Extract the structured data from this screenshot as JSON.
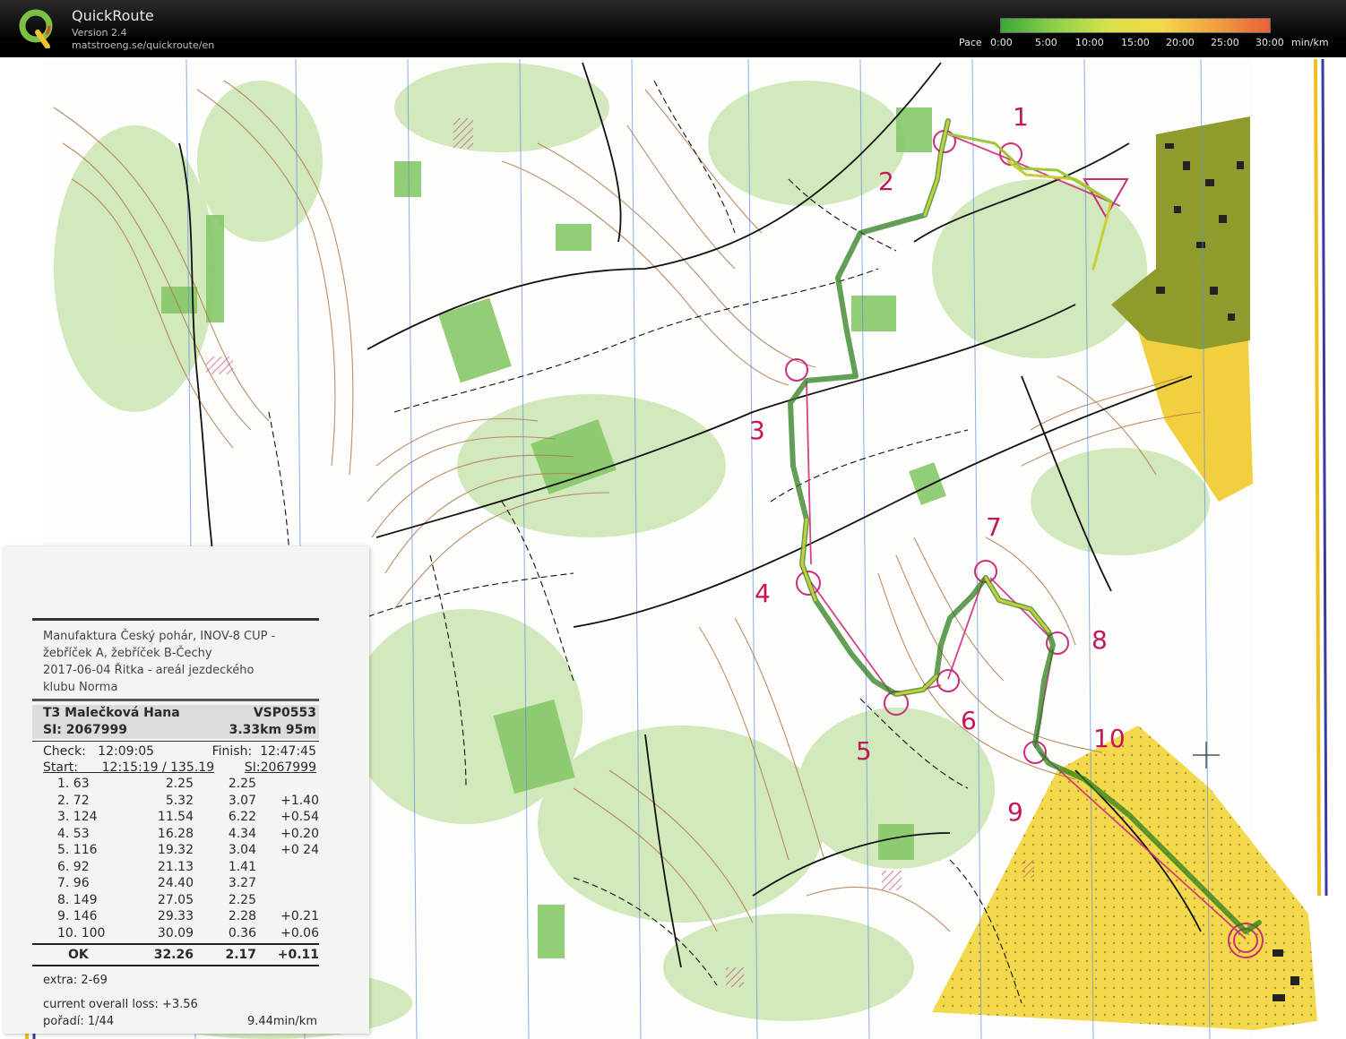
{
  "app": {
    "name": "QuickRoute",
    "version": "Version 2.4",
    "url": "matstroeng.se/quickroute/en"
  },
  "pace_legend": {
    "label": "Pace",
    "ticks": [
      "0:00",
      "5:00",
      "10:00",
      "15:00",
      "20:00",
      "25:00",
      "30:00"
    ],
    "unit": "min/km",
    "colors": [
      "#3aa83a",
      "#8cd04a",
      "#d8e24a",
      "#f4d84a",
      "#f0a040",
      "#e8603a"
    ]
  },
  "map": {
    "control_numbers": [
      "1",
      "2",
      "3",
      "4",
      "5",
      "6",
      "7",
      "8",
      "9",
      "10"
    ],
    "colors": {
      "forest_green": "#7cc65a",
      "light_green": "#c8e6b0",
      "open_yellow": "#f2d64a",
      "contour_brown": "#b0764a",
      "control_magenta": "#c2185b",
      "track_green": "#4c9a2a",
      "track_yellow": "#d6d43a",
      "settlement_olive": "#8e9a2a",
      "grid_blue": "#4a7ee0"
    }
  },
  "receipt": {
    "event_lines": [
      "Manufaktura Český pohár, INOV-8 CUP -",
      "žebříček A, žebříček B-Čechy",
      "2017-06-04 Řitka - areál jezdeckého",
      "klubu Norma"
    ],
    "runner": "T3 Malečková Hana",
    "club": "VSP0553",
    "si": "SI: 2067999",
    "course": "3.33km 95m",
    "check_label": "Check:",
    "check_time": "12:09:05",
    "finish_label": "Finish:",
    "finish_time": "12:47:45",
    "start_label": "Start:",
    "start_time": "12:15:19 / 135.19",
    "start_si": "SI:2067999",
    "splits": [
      {
        "n": "1. 63",
        "t": "2.25",
        "l": "2.25",
        "d": "",
        "loss": ""
      },
      {
        "n": "2. 72",
        "t": "5.32",
        "l": "3.07",
        "d": "",
        "loss": "+1.40"
      },
      {
        "n": "3. 124",
        "t": "11.54",
        "l": "6.22",
        "d": "",
        "loss": "+0.54"
      },
      {
        "n": "4. 53",
        "t": "16.28",
        "l": "4.34",
        "d": "",
        "loss": "+0.20"
      },
      {
        "n": "5. 116",
        "t": "19.32",
        "l": "3.04",
        "d": "",
        "loss": "+0 24"
      },
      {
        "n": "6. 92",
        "t": "21.13",
        "l": "1.41",
        "d": "",
        "loss": ""
      },
      {
        "n": "7. 96",
        "t": "24.40",
        "l": "3.27",
        "d": "",
        "loss": ""
      },
      {
        "n": "8. 149",
        "t": "27.05",
        "l": "2.25",
        "d": "",
        "loss": ""
      },
      {
        "n": "9. 146",
        "t": "29.33",
        "l": "2.28",
        "d": "",
        "loss": "+0.21"
      },
      {
        "n": "10. 100",
        "t": "30.09",
        "l": "0.36",
        "d": "",
        "loss": "+0.06"
      }
    ],
    "ok": {
      "label": "OK",
      "t": "32.26",
      "l": "2.17",
      "loss": "+0.11"
    },
    "extra": "extra: 2-69",
    "overall_loss": "current overall loss: +3.56",
    "place": "pořadí: 1/44",
    "pace": "9.44min/km"
  }
}
